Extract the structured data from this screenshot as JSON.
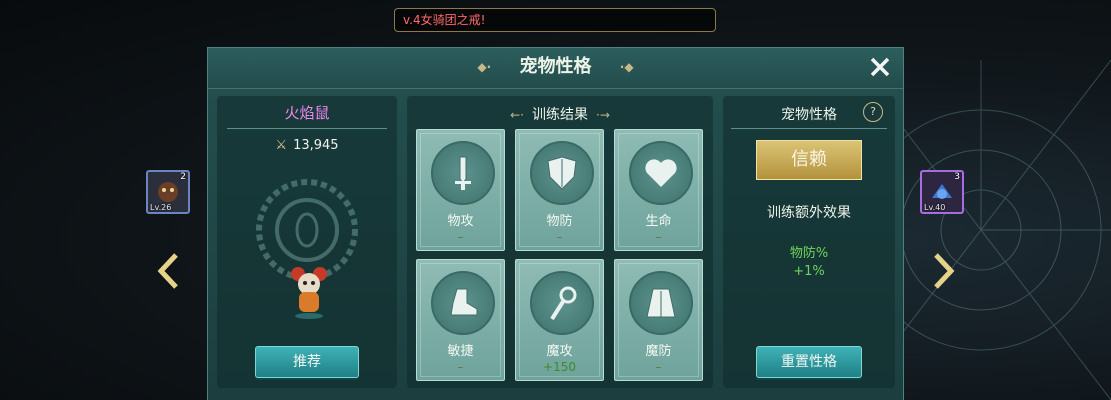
{
  "notice": {
    "text": "v.4女骑团之戒!"
  },
  "panel": {
    "title": "宠物性格"
  },
  "pet": {
    "name": "火焰鼠",
    "power": "13,945",
    "recommend_label": "推荐"
  },
  "training": {
    "title": "训练结果",
    "stats": [
      {
        "label": "物攻",
        "value": "–",
        "icon": "sword-icon"
      },
      {
        "label": "物防",
        "value": "–",
        "icon": "shield-icon"
      },
      {
        "label": "生命",
        "value": "–",
        "icon": "heart-icon"
      },
      {
        "label": "敏捷",
        "value": "–",
        "icon": "boot-icon"
      },
      {
        "label": "魔攻",
        "value": "+150",
        "icon": "staff-icon"
      },
      {
        "label": "魔防",
        "value": "–",
        "icon": "cloak-icon"
      }
    ]
  },
  "trait": {
    "title": "宠物性格",
    "help": "?",
    "current": "信赖",
    "extra_title": "训练额外效果",
    "extra_stat": "物防%",
    "extra_value": "+1%",
    "reset_label": "重置性格"
  },
  "side": {
    "left": {
      "level": "Lv.26",
      "count": "2"
    },
    "right": {
      "level": "Lv.40",
      "count": "3"
    }
  },
  "colors": {
    "accent_gold": "#d4b660",
    "panel": "#24504f",
    "button": "#2f9aa0",
    "positive": "#6fd45a",
    "pet_name": "#f087f0"
  }
}
